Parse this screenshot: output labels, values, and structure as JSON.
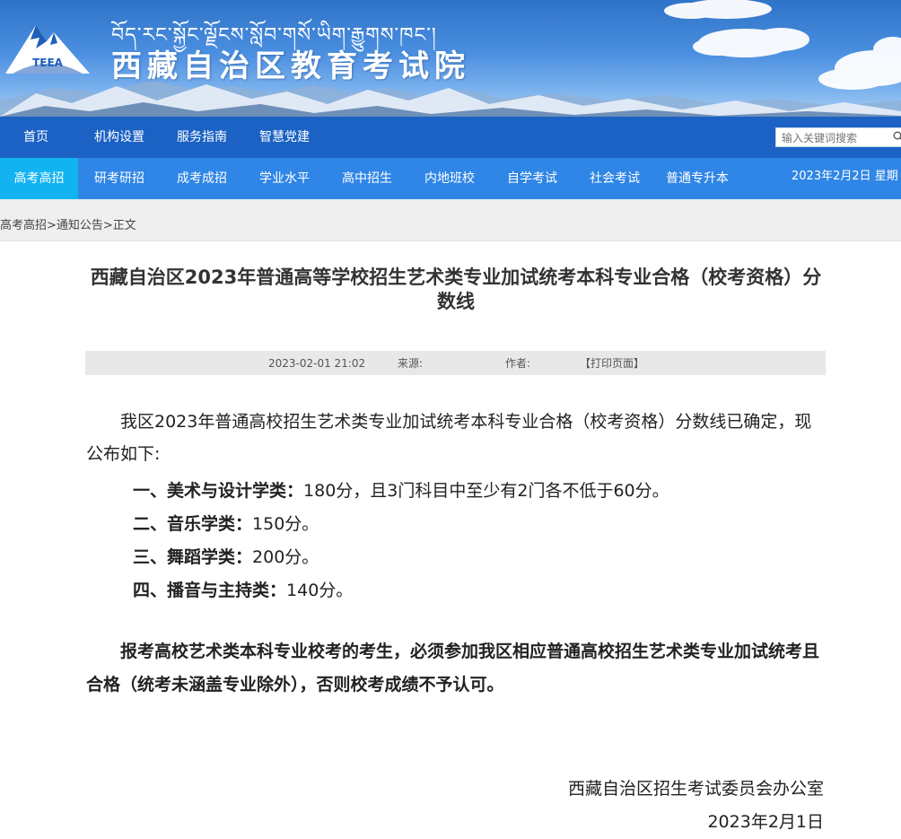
{
  "banner": {
    "logo_text": "TEEA",
    "tibetan_name": "བོད་རང་སྐྱོང་ལྗོངས་སློབ་གསོ་ཡིག་རྒྱུགས་ཁང་།",
    "site_name": "西藏自治区教育考试院"
  },
  "nav_primary": {
    "items": [
      {
        "label": "首页"
      },
      {
        "label": "机构设置"
      },
      {
        "label": "服务指南"
      },
      {
        "label": "智慧党建"
      }
    ]
  },
  "search": {
    "placeholder": "输入关键词搜索",
    "icon": "search-icon"
  },
  "nav_secondary": {
    "active_index": 0,
    "items": [
      {
        "label": "高考高招"
      },
      {
        "label": "研考研招"
      },
      {
        "label": "成考成招"
      },
      {
        "label": "学业水平"
      },
      {
        "label": "高中招生"
      },
      {
        "label": "内地班校"
      },
      {
        "label": "自学考试"
      },
      {
        "label": "社会考试"
      },
      {
        "label": "普通专升本"
      }
    ],
    "date": "2023年2月2日 星期"
  },
  "breadcrumb": "高考高招>通知公告>正文",
  "article": {
    "title": "西藏自治区2023年普通高等学校招生艺术类专业加试统考本科专业合格（校考资格）分数线",
    "meta": {
      "date": "2023-02-01 21:02",
      "source_label": "来源:",
      "author_label": "作者:",
      "print_label": "【打印页面】"
    },
    "intro": "我区2023年普通高校招生艺术类专业加试统考本科专业合格（校考资格）分数线已确定，现公布如下:",
    "items": [
      {
        "label": "一、美术与设计学类：",
        "text": "180分，且3门科目中至少有2门各不低于60分。"
      },
      {
        "label": "二、音乐学类：",
        "text": "150分。"
      },
      {
        "label": "三、舞蹈学类：",
        "text": "200分。"
      },
      {
        "label": "四、播音与主持类：",
        "text": "140分。"
      }
    ],
    "notice": "报考高校艺术类本科专业校考的考生，必须参加我区相应普通高校招生艺术类专业加试统考且合格（统考未涵盖专业除外），否则校考成绩不予认可。",
    "signature_org": "西藏自治区招生考试委员会办公室",
    "signature_date": "2023年2月1日"
  },
  "colors": {
    "nav_primary_bg": "#1b62c4",
    "nav_secondary_bg": "#2f86e6",
    "nav_active_bg": "#12b3f0",
    "breadcrumb_bg": "#efefef"
  }
}
